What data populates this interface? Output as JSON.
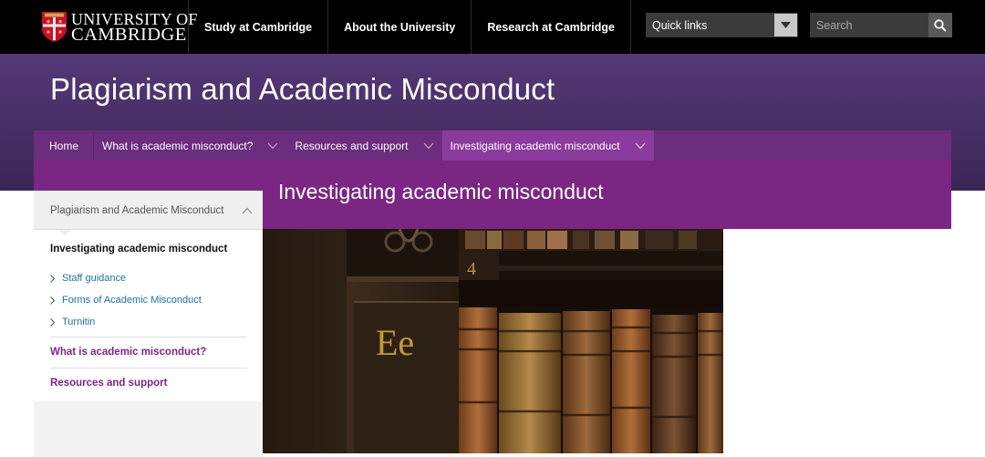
{
  "header": {
    "logo": {
      "line1": "UNIVERSITY OF",
      "line2": "CAMBRIDGE"
    },
    "nav": [
      {
        "label": "Study at Cambridge"
      },
      {
        "label": "About the University"
      },
      {
        "label": "Research at Cambridge"
      }
    ],
    "quick_links": {
      "label": "Quick links",
      "icon": "chevron-down-icon"
    },
    "search": {
      "placeholder": "Search",
      "icon": "search-icon"
    }
  },
  "banner": {
    "title": "Plagiarism and Academic Misconduct"
  },
  "section_nav": [
    {
      "label": "Home"
    },
    {
      "label": "What is academic misconduct?"
    },
    {
      "label": "Resources and support"
    },
    {
      "label": "Investigating academic misconduct",
      "active": true
    }
  ],
  "page": {
    "title": "Investigating academic misconduct"
  },
  "sidebar": {
    "parent": "Plagiarism and Academic Misconduct",
    "current": "Investigating academic misconduct",
    "children": [
      {
        "label": "Staff guidance"
      },
      {
        "label": "Forms of Academic Misconduct"
      },
      {
        "label": "Turnitin"
      }
    ],
    "siblings": [
      {
        "label": "What is academic misconduct?"
      },
      {
        "label": "Resources and support"
      }
    ]
  },
  "hero": {
    "letters": "Ee",
    "shelf_number": "4"
  },
  "colors": {
    "topbar": "#000000",
    "banner": "#4a3068",
    "section_nav": "#6b2d7d",
    "section_nav_active": "#8b3a9e",
    "page_header": "#7b2682",
    "link": "#1d6fa4",
    "accent": "#7b2682"
  }
}
